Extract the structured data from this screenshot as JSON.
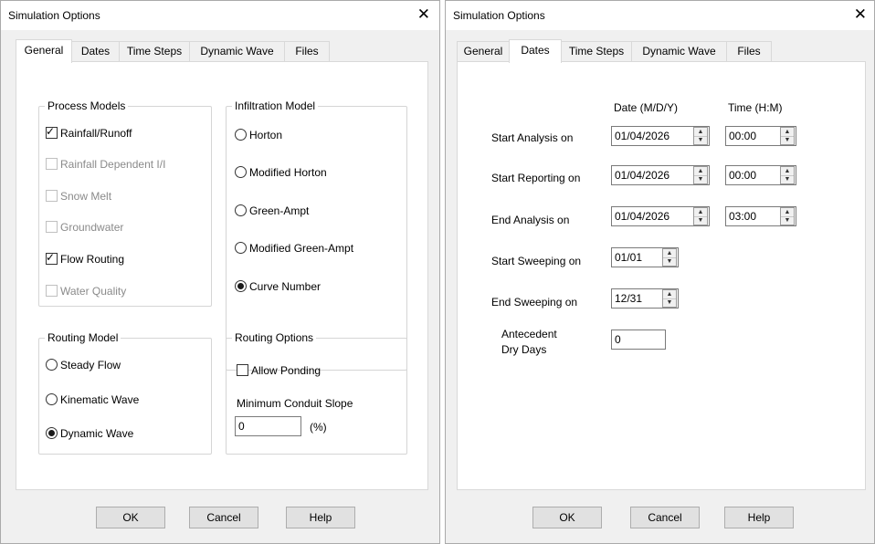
{
  "left_window": {
    "title": "Simulation Options",
    "tabs": [
      "General",
      "Dates",
      "Time Steps",
      "Dynamic Wave",
      "Files"
    ],
    "active_tab": "General",
    "process_models": {
      "label": "Process Models",
      "items": [
        {
          "label": "Rainfall/Runoff",
          "checked": true,
          "enabled": true
        },
        {
          "label": "Rainfall Dependent I/I",
          "checked": false,
          "enabled": false
        },
        {
          "label": "Snow Melt",
          "checked": false,
          "enabled": false
        },
        {
          "label": "Groundwater",
          "checked": false,
          "enabled": false
        },
        {
          "label": "Flow Routing",
          "checked": true,
          "enabled": true
        },
        {
          "label": "Water Quality",
          "checked": false,
          "enabled": false
        }
      ]
    },
    "infiltration_model": {
      "label": "Infiltration Model",
      "items": [
        {
          "label": "Horton",
          "selected": false
        },
        {
          "label": "Modified Horton",
          "selected": false
        },
        {
          "label": "Green-Ampt",
          "selected": false
        },
        {
          "label": "Modified Green-Ampt",
          "selected": false
        },
        {
          "label": "Curve Number",
          "selected": true
        }
      ]
    },
    "routing_model": {
      "label": "Routing Model",
      "items": [
        {
          "label": "Steady Flow",
          "selected": false
        },
        {
          "label": "Kinematic Wave",
          "selected": false
        },
        {
          "label": "Dynamic Wave",
          "selected": true
        }
      ]
    },
    "routing_options": {
      "label": "Routing Options",
      "allow_ponding": {
        "label": "Allow Ponding",
        "checked": false
      },
      "min_slope_label": "Minimum Conduit Slope",
      "min_slope_value": "0",
      "min_slope_unit": "(%)"
    },
    "buttons": {
      "ok": "OK",
      "cancel": "Cancel",
      "help": "Help"
    }
  },
  "right_window": {
    "title": "Simulation Options",
    "tabs": [
      "General",
      "Dates",
      "Time Steps",
      "Dynamic Wave",
      "Files"
    ],
    "active_tab": "Dates",
    "date_header": "Date (M/D/Y)",
    "time_header": "Time (H:M)",
    "rows": {
      "start_analysis": {
        "label": "Start Analysis on",
        "date": "01/04/2026",
        "time": "00:00"
      },
      "start_reporting": {
        "label": "Start Reporting on",
        "date": "01/04/2026",
        "time": "00:00"
      },
      "end_analysis": {
        "label": "End Analysis on",
        "date": "01/04/2026",
        "time": "03:00"
      },
      "start_sweeping": {
        "label": "Start Sweeping on",
        "date": "01/01"
      },
      "end_sweeping": {
        "label": "End Sweeping on",
        "date": "12/31"
      }
    },
    "antecedent": {
      "label_line1": "Antecedent",
      "label_line2": "Dry Days",
      "value": "0"
    },
    "buttons": {
      "ok": "OK",
      "cancel": "Cancel",
      "help": "Help"
    }
  },
  "icons": {
    "close": "close-icon",
    "spin": "spin-arrows-icon",
    "check": "check-mark-icon",
    "radio": "radio-dot-icon"
  }
}
